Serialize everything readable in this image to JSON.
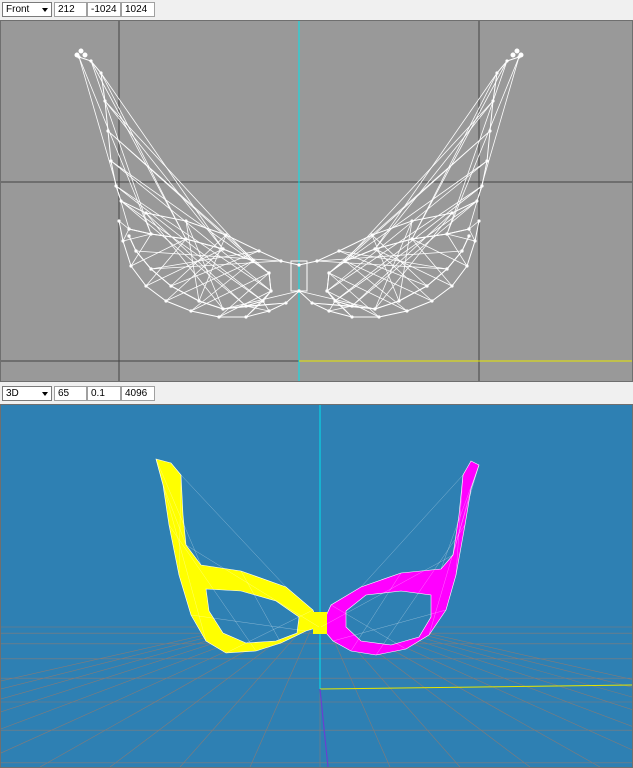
{
  "top_view": {
    "view_mode": "Front",
    "field_1": "212",
    "field_2": "-1024",
    "field_3": "1024"
  },
  "bottom_view": {
    "view_mode": "3D",
    "field_1": "65",
    "field_2": "0.1",
    "field_3": "4096"
  },
  "colors": {
    "ortho_background": "#999999",
    "perspective_background": "#2e80b3",
    "mesh_wire": "#ffffff",
    "left_half": "#ffff00",
    "right_half": "#ff00ff",
    "axis_cyan": "#00e5ee",
    "axis_yellow": "#e6e600"
  },
  "icons": {
    "dropdown": "chevron-down-icon"
  }
}
